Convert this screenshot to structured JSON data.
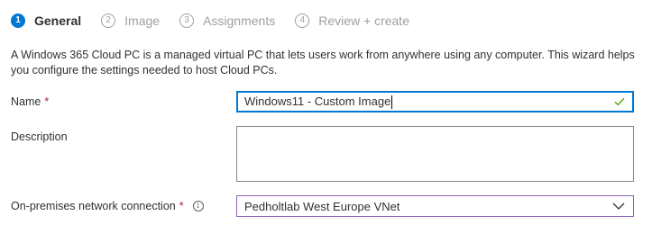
{
  "wizard": {
    "steps": [
      {
        "number": "1",
        "label": "General",
        "state": "active"
      },
      {
        "number": "2",
        "label": "Image",
        "state": "inactive"
      },
      {
        "number": "3",
        "label": "Assignments",
        "state": "inactive"
      },
      {
        "number": "4",
        "label": "Review + create",
        "state": "inactive"
      }
    ]
  },
  "intro": "A Windows 365 Cloud PC is a managed virtual PC that lets users work from anywhere using any computer. This wizard helps you configure the settings needed to host Cloud PCs.",
  "form": {
    "name": {
      "label": "Name",
      "required_marker": "*",
      "value": "Windows11 - Custom Image",
      "valid_icon": "checkmark-icon"
    },
    "description": {
      "label": "Description",
      "value": ""
    },
    "network": {
      "label": "On-premises network connection",
      "required_marker": "*",
      "info_icon": "info-icon",
      "value": "Pedholtlab West Europe VNet"
    }
  },
  "colors": {
    "accent": "#0078d4",
    "required": "#a4262c",
    "valid": "#57a300",
    "dropdown_border": "#8764b8",
    "inactive": "#a19f9d"
  }
}
